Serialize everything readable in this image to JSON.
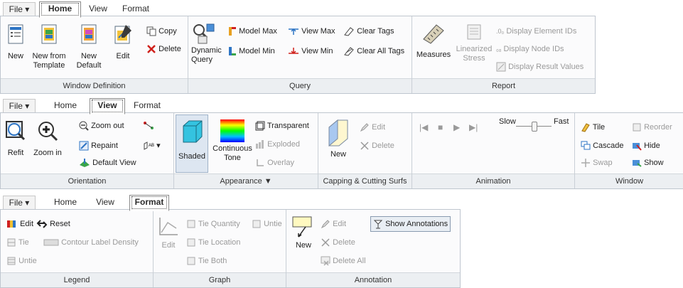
{
  "home": {
    "tabs": [
      "File ▾",
      "Home",
      "View",
      "Format"
    ],
    "window_def": {
      "label": "Window Definition",
      "new": "New",
      "new_template": "New from Template",
      "new_default": "New Default",
      "edit": "Edit",
      "copy": "Copy",
      "delete": "Delete"
    },
    "query": {
      "label": "Query",
      "dynamic": "Dynamic Query",
      "model_max": "Model Max",
      "model_min": "Model Min",
      "view_max": "View Max",
      "view_min": "View Min",
      "clear_tags": "Clear Tags",
      "clear_all": "Clear All Tags"
    },
    "report": {
      "label": "Report",
      "measures": "Measures",
      "linearized": "Linearized Stress",
      "elem_ids": "Display Element IDs",
      "node_ids": "Display Node IDs",
      "result_values": "Display Result Values"
    }
  },
  "view": {
    "tabs": [
      "File ▾",
      "Home",
      "View",
      "Format"
    ],
    "orientation": {
      "label": "Orientation",
      "refit": "Refit",
      "zoom_in": "Zoom in",
      "zoom_out": "Zoom out",
      "repaint": "Repaint",
      "default_view": "Default View"
    },
    "appearance": {
      "label": "Appearance ▼",
      "shaded": "Shaded",
      "continuous": "Continuous Tone",
      "transparent": "Transparent",
      "exploded": "Exploded",
      "overlay": "Overlay"
    },
    "capping": {
      "label": "Capping & Cutting Surfs",
      "new": "New",
      "edit": "Edit",
      "delete": "Delete"
    },
    "animation": {
      "label": "Animation",
      "slow": "Slow",
      "fast": "Fast"
    },
    "window": {
      "label": "Window",
      "tile": "Tile",
      "cascade": "Cascade",
      "swap": "Swap",
      "reorder": "Reorder",
      "hide": "Hide",
      "show": "Show"
    }
  },
  "format": {
    "tabs": [
      "File ▾",
      "Home",
      "View",
      "Format"
    ],
    "legend": {
      "label": "Legend",
      "edit": "Edit",
      "reset": "Reset",
      "tie": "Tie",
      "contour": "Contour Label Density",
      "untie": "Untie"
    },
    "graph": {
      "label": "Graph",
      "edit": "Edit",
      "tie_qty": "Tie Quantity",
      "untie": "Untie",
      "tie_loc": "Tie Location",
      "tie_both": "Tie Both"
    },
    "annotation": {
      "label": "Annotation",
      "new": "New",
      "edit": "Edit",
      "delete": "Delete",
      "delete_all": "Delete All",
      "show": "Show Annotations"
    }
  },
  "colors": {
    "accent": "#1f6fc6",
    "delete_red": "#d0201b",
    "group_bg": "#eceff2"
  }
}
